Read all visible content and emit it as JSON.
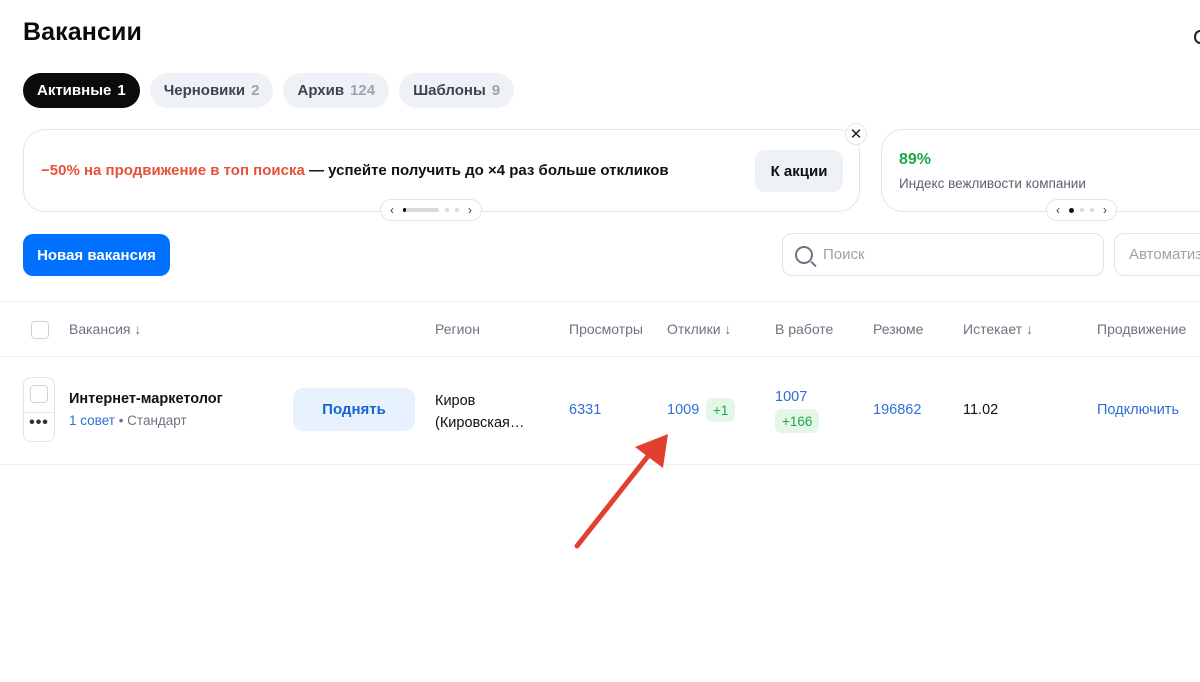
{
  "page": {
    "title": "Вакансии"
  },
  "tabs": [
    {
      "label": "Активные",
      "count": "1",
      "active": true
    },
    {
      "label": "Черновики",
      "count": "2"
    },
    {
      "label": "Архив",
      "count": "124"
    },
    {
      "label": "Шаблоны",
      "count": "9"
    }
  ],
  "promo": {
    "accent_text": "−50% на продвижение в топ поиска",
    "text": " — успейте получить до ×4 раз больше откликов",
    "button_label": "К акции",
    "close_label": "✕"
  },
  "index_card": {
    "value": "89%",
    "label": "Индекс вежливости компании"
  },
  "toolbar": {
    "new_vacancy_label": "Новая вакансия",
    "search_placeholder": "Поиск",
    "automation_label": "Автоматизация"
  },
  "table": {
    "columns": {
      "vacancy": "Вакансия ↓",
      "region": "Регион",
      "views": "Просмотры",
      "responses": "Отклики ↓",
      "in_work": "В работе",
      "resume": "Резюме",
      "expires": "Истекает ↓",
      "promotion": "Продвижение"
    },
    "rows": [
      {
        "title": "Интернет-маркетолог",
        "tips": "1 совет",
        "separator": " • ",
        "plan": "Стандарт",
        "raise_label": "Поднять",
        "region_line1": "Киров",
        "region_line2": "(Кировская…",
        "views": "6331",
        "responses": "1009",
        "responses_new": "+1",
        "in_work": "1007",
        "in_work_new": "+166",
        "resume": "196862",
        "expires": "11.02",
        "promotion_link": "Подключить"
      }
    ]
  },
  "colors": {
    "accent_blue": "#0070ff",
    "link_blue": "#2f6fd3",
    "promo_red": "#e8513a",
    "success_green": "#1fa64b",
    "annotation_arrow": "#e2402f"
  }
}
